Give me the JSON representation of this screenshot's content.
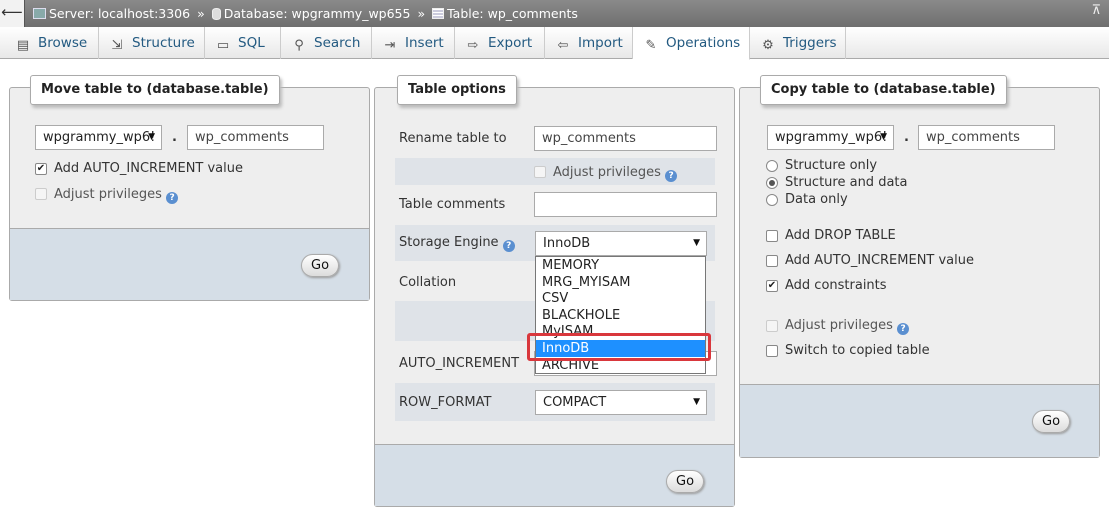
{
  "breadcrumb": {
    "back_glyph": "⟵",
    "server": "Server: localhost:3306",
    "database": "Database: wpgrammy_wp655",
    "table": "Table: wp_comments",
    "sep": "»",
    "collapse_glyph": "⊼"
  },
  "tabs": [
    {
      "label": "Browse",
      "icon": "browse-icon",
      "glyph": "▤"
    },
    {
      "label": "Structure",
      "icon": "structure-icon",
      "glyph": "⇲"
    },
    {
      "label": "SQL",
      "icon": "sql-icon",
      "glyph": "▭"
    },
    {
      "label": "Search",
      "icon": "search-icon",
      "glyph": "⚲"
    },
    {
      "label": "Insert",
      "icon": "insert-icon",
      "glyph": "⇥"
    },
    {
      "label": "Export",
      "icon": "export-icon",
      "glyph": "⇨"
    },
    {
      "label": "Import",
      "icon": "import-icon",
      "glyph": "⇦"
    },
    {
      "label": "Operations",
      "icon": "wrench-icon",
      "glyph": "✎",
      "active": true
    },
    {
      "label": "Triggers",
      "icon": "triggers-icon",
      "glyph": "⚙"
    }
  ],
  "move_table": {
    "legend": "Move table to (database.table)",
    "db_select": "wpgrammy_wp6!",
    "dot": ".",
    "table_value": "wp_comments",
    "auto_increment_label": "Add AUTO_INCREMENT value",
    "auto_increment_checked": true,
    "adjust_privileges_label": "Adjust privileges",
    "go": "Go"
  },
  "table_options": {
    "legend": "Table options",
    "rename_label": "Rename table to",
    "rename_value": "wp_comments",
    "adjust_privileges_label": "Adjust privileges",
    "comments_label": "Table comments",
    "comments_value": "",
    "engine_label": "Storage Engine",
    "engine_value": "InnoDB",
    "engine_options": [
      "MEMORY",
      "MRG_MYISAM",
      "CSV",
      "BLACKHOLE",
      "MyISAM",
      "InnoDB",
      "ARCHIVE"
    ],
    "engine_highlighted": "InnoDB",
    "collation_label": "Collation",
    "auto_increment_label": "AUTO_INCREMENT",
    "row_format_label": "ROW_FORMAT",
    "row_format_value": "COMPACT",
    "go": "Go"
  },
  "copy_table": {
    "legend": "Copy table to (database.table)",
    "db_select": "wpgrammy_wp6!",
    "dot": ".",
    "table_value": "wp_comments",
    "radio_options": [
      {
        "label": "Structure only",
        "checked": false
      },
      {
        "label": "Structure and data",
        "checked": true
      },
      {
        "label": "Data only",
        "checked": false
      }
    ],
    "checkboxes": [
      {
        "label": "Add DROP TABLE",
        "checked": false
      },
      {
        "label": "Add AUTO_INCREMENT value",
        "checked": false
      },
      {
        "label": "Add constraints",
        "checked": true
      }
    ],
    "adjust_privileges_label": "Adjust privileges",
    "switch_label": "Switch to copied table",
    "go": "Go"
  },
  "help_glyph": "?",
  "check_glyph": "✔",
  "arrow_glyph": "▼",
  "colors": {
    "highlight": "#1e90ff",
    "annotation": "#d9373c",
    "link": "#235a81"
  }
}
